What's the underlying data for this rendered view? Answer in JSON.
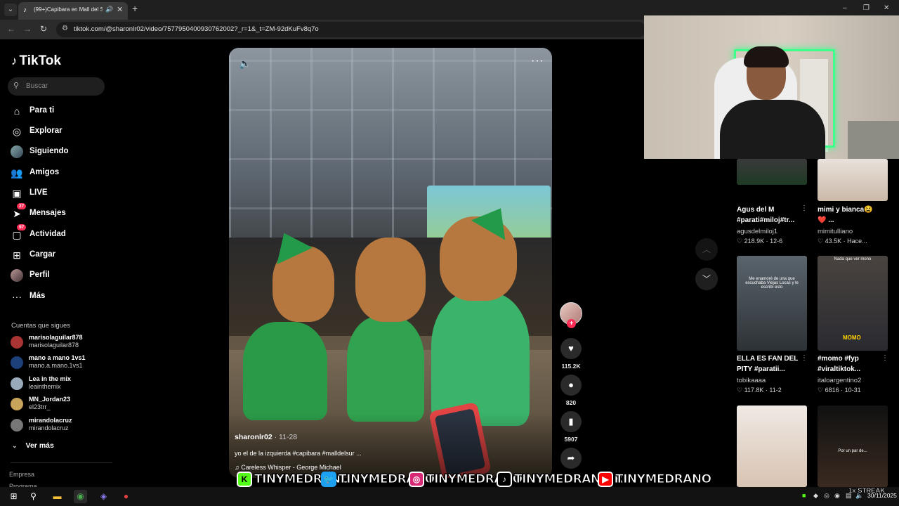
{
  "browser": {
    "tab_title": "(99+)Capibara en Mall del S",
    "url": "tiktok.com/@sharonlr02/video/7577950400930762002?_r=1&_t=ZM-92dKuFv8q7o",
    "new_tab": "+",
    "window_controls": [
      "–",
      "❐",
      "✕"
    ]
  },
  "sidebar": {
    "brand": "TikTok",
    "search_placeholder": "Buscar",
    "nav": [
      {
        "label": "Para ti",
        "icon": "home-icon"
      },
      {
        "label": "Explorar",
        "icon": "compass-icon"
      },
      {
        "label": "Siguiendo",
        "icon": "following-avatar"
      },
      {
        "label": "Amigos",
        "icon": "friends-icon"
      },
      {
        "label": "LIVE",
        "icon": "live-icon"
      },
      {
        "label": "Mensajes",
        "icon": "messages-icon",
        "badge": "27"
      },
      {
        "label": "Actividad",
        "icon": "activity-icon",
        "badge": "97"
      },
      {
        "label": "Cargar",
        "icon": "upload-icon"
      },
      {
        "label": "Perfil",
        "icon": "profile-avatar"
      },
      {
        "label": "Más",
        "icon": "more-icon"
      }
    ],
    "following_title": "Cuentas que sigues",
    "following": [
      {
        "name": "marisolaguilar878",
        "handle": "marisolaguilar878"
      },
      {
        "name": "mano a mano 1vs1",
        "handle": "mano.a.mano.1vs1"
      },
      {
        "name": "Lea in the mix",
        "handle": "leainthemix"
      },
      {
        "name": "MN_Jordan23",
        "handle": "el23trr_"
      },
      {
        "name": "mirandolacruz",
        "handle": "mirandolacruz"
      }
    ],
    "see_more": "Ver más",
    "footer": [
      "Empresa",
      "Programa"
    ]
  },
  "video": {
    "author": "sharonlr02",
    "date": "· 11-28",
    "description": "yo el de la izquierda #capibara #malldelsur ...",
    "music": "♫  Careless Whisper - George Michael",
    "actions": {
      "likes": "115.2K",
      "comments": "820",
      "saves": "5907",
      "follow_plus": "+"
    }
  },
  "grid": [
    {
      "title1": "Agus del M",
      "title2": "#parati#miloj#tr...",
      "user": "agusdelmiloj1",
      "stats": "♡ 218.9K · 12-6"
    },
    {
      "title1": "mimi y bianca😫",
      "title2": "❤️ ...",
      "user": "mimitulliano",
      "stats": "♡ 43.5K · Hace..."
    },
    {
      "title1": "ELLA ES FAN DEL",
      "title2": "PITY #paratii...",
      "user": "tobikaaaa",
      "stats": "♡ 117.8K · 11-2",
      "overlay": "Me enamoré de una que escuchaba Viejas Locas y le escribí esto"
    },
    {
      "title1": "#momo #fyp",
      "title2": "#viraltiktok...",
      "user": "italoargentino2",
      "stats": "♡ 6816 · 10-31",
      "overlay": "Nada que ver mono",
      "tag": "MOMO"
    },
    {
      "title1": "",
      "title2": "",
      "user": "",
      "stats": ""
    },
    {
      "title1": "",
      "title2": "",
      "user": "",
      "stats": "",
      "overlay": "Por un par de..."
    }
  ],
  "overlay_social": [
    {
      "icon": "K",
      "handle": "TINYMEDRANO",
      "color": "#53fc18"
    },
    {
      "icon": "🐦",
      "handle": "TINYMEDRANO",
      "color": "#1da1f2"
    },
    {
      "icon": "◎",
      "handle": "TINYMEDRANO",
      "color": "#d62976"
    },
    {
      "icon": "♪",
      "handle": "TINYMEDRANOJR",
      "color": "#000000"
    },
    {
      "icon": "▶",
      "handle": "TINYMEDRANO",
      "color": "#ff0000"
    }
  ],
  "taskbar": {
    "streak": "1x STREAK",
    "date": "30/11/2025"
  }
}
